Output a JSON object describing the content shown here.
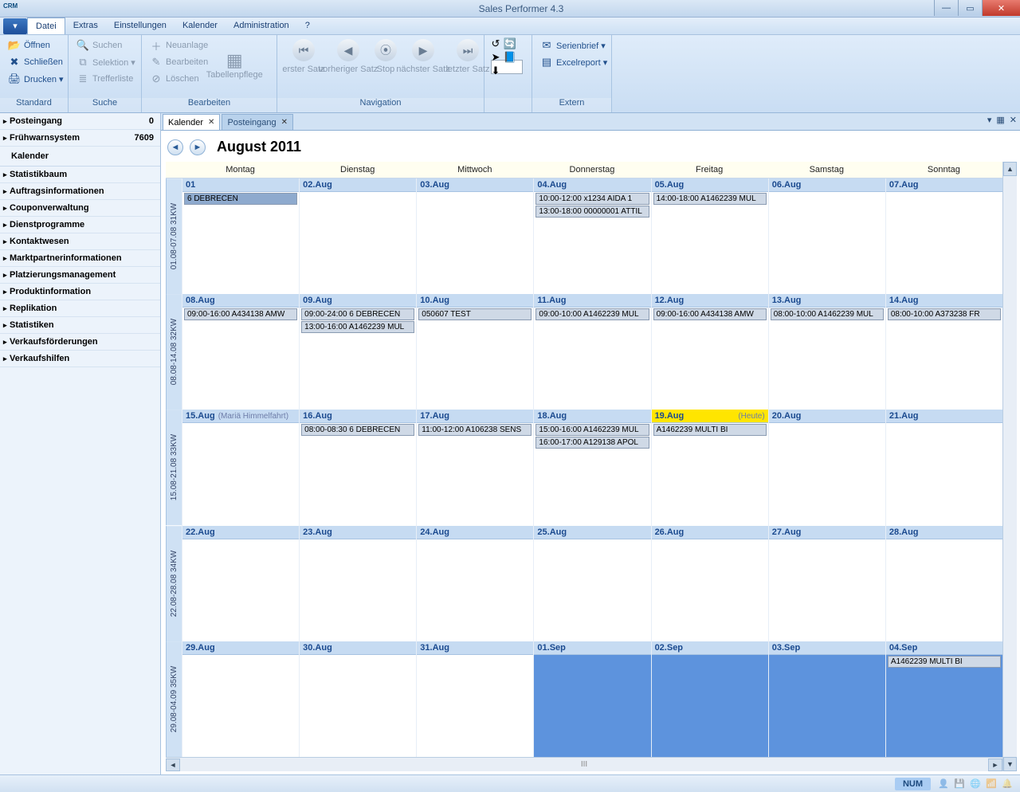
{
  "window": {
    "title": "Sales Performer 4.3",
    "app_icon_label": "CRM"
  },
  "menu": {
    "items": [
      "Datei",
      "Extras",
      "Einstellungen",
      "Kalender",
      "Administration",
      "?"
    ],
    "active_index": 0
  },
  "ribbon": {
    "groups": [
      {
        "label": "Standard",
        "buttons": [
          {
            "label": "Öffnen",
            "icon": "📂"
          },
          {
            "label": "Schließen",
            "icon": "✖"
          },
          {
            "label": "Drucken ▾",
            "icon": "🖨"
          }
        ]
      },
      {
        "label": "Suche",
        "buttons": [
          {
            "label": "Suchen",
            "icon": "🔍",
            "disabled": true
          },
          {
            "label": "Selektion ▾",
            "icon": "⧉",
            "disabled": true
          },
          {
            "label": "Trefferliste",
            "icon": "≣",
            "disabled": true
          }
        ]
      },
      {
        "label": "Bearbeiten",
        "buttons_col": [
          {
            "label": "Neuanlage",
            "icon": "＋",
            "disabled": true
          },
          {
            "label": "Bearbeiten",
            "icon": "✎",
            "disabled": true
          },
          {
            "label": "Löschen",
            "icon": "⊘",
            "disabled": true
          }
        ],
        "big": {
          "label": "Tabellenpflege",
          "icon": "▦",
          "disabled": true
        }
      },
      {
        "label": "Navigation",
        "nav": [
          {
            "label": "erster Satz",
            "glyph": "⏮"
          },
          {
            "label": "vorheriger Satz",
            "glyph": "◀"
          },
          {
            "label": "Stop",
            "glyph": "⦿"
          },
          {
            "label": "nächster Satz",
            "glyph": "▶"
          },
          {
            "label": "letzter Satz",
            "glyph": "⏭"
          }
        ],
        "input_value": ""
      },
      {
        "label": "",
        "mini_icons": true
      },
      {
        "label": "Extern",
        "buttons": [
          {
            "label": "Serienbrief ▾",
            "icon": "✉"
          },
          {
            "label": "Excelreport ▾",
            "icon": "▤"
          }
        ]
      }
    ]
  },
  "nav": {
    "rows": [
      {
        "label": "Posteingang",
        "count": "0"
      },
      {
        "label": "Frühwarnsystem",
        "count": "7609"
      }
    ],
    "sub": "Kalender",
    "items": [
      "Statistikbaum",
      "Auftragsinformationen",
      "Couponverwaltung",
      "Dienstprogramme",
      "Kontaktwesen",
      "Marktpartnerinformationen",
      "Platzierungsmanagement",
      "Produktinformation",
      "Replikation",
      "Statistiken",
      "Verkaufsförderungen",
      "Verkaufshilfen"
    ]
  },
  "tabs": [
    {
      "label": "Kalender",
      "active": true
    },
    {
      "label": "Posteingang",
      "active": false
    }
  ],
  "calendar": {
    "title": "August 2011",
    "days_of_week": [
      "Montag",
      "Dienstag",
      "Mittwoch",
      "Donnerstag",
      "Freitag",
      "Samstag",
      "Sonntag"
    ],
    "weeks": [
      {
        "gutter": "01.08-07.08  31KW",
        "days": [
          {
            "head": "01",
            "events": [
              {
                "t": "6 DEBRECEN",
                "sel": true
              }
            ]
          },
          {
            "head": "02.Aug"
          },
          {
            "head": "03.Aug"
          },
          {
            "head": "04.Aug",
            "events": [
              {
                "t": "10:00-12:00 x1234 AIDA 1"
              },
              {
                "t": "13:00-18:00 00000001 ATTIL"
              }
            ]
          },
          {
            "head": "05.Aug",
            "events": [
              {
                "t": "14:00-18:00  A1462239 MUL"
              }
            ]
          },
          {
            "head": "06.Aug"
          },
          {
            "head": "07.Aug"
          }
        ]
      },
      {
        "gutter": "08.08-14.08  32KW",
        "days": [
          {
            "head": "08.Aug",
            "events": [
              {
                "t": "09:00-16:00 A434138 AMW"
              }
            ]
          },
          {
            "head": "09.Aug",
            "events": [
              {
                "t": "09:00-24:00 6 DEBRECEN"
              },
              {
                "t": "13:00-16:00  A1462239 MUL"
              }
            ]
          },
          {
            "head": "10.Aug",
            "events": [
              {
                "t": "050607 TEST"
              }
            ]
          },
          {
            "head": "11.Aug",
            "events": [
              {
                "t": "09:00-10:00  A1462239 MUL"
              }
            ]
          },
          {
            "head": "12.Aug",
            "events": [
              {
                "t": "09:00-16:00 A434138 AMW"
              }
            ]
          },
          {
            "head": "13.Aug",
            "events": [
              {
                "t": "08:00-10:00  A1462239 MUL"
              }
            ]
          },
          {
            "head": "14.Aug",
            "events": [
              {
                "t": "08:00-10:00  A373238 FR"
              }
            ]
          }
        ]
      },
      {
        "gutter": "15.08-21.08  33KW",
        "days": [
          {
            "head": "15.Aug",
            "sub": "(Mariä Himmelfahrt)"
          },
          {
            "head": "16.Aug",
            "events": [
              {
                "t": "08:00-08:30 6 DEBRECEN"
              }
            ]
          },
          {
            "head": "17.Aug",
            "events": [
              {
                "t": "11:00-12:00 A106238 SENS"
              }
            ]
          },
          {
            "head": "18.Aug",
            "events": [
              {
                "t": "15:00-16:00  A1462239 MUL"
              },
              {
                "t": "16:00-17:00  A129138 APOL"
              }
            ]
          },
          {
            "head": "19.Aug",
            "today": true,
            "heute": "(Heute)",
            "events": [
              {
                "t": "A1462239 MULTI BI"
              }
            ]
          },
          {
            "head": "20.Aug"
          },
          {
            "head": "21.Aug"
          }
        ]
      },
      {
        "gutter": "22.08-28.08  34KW",
        "days": [
          {
            "head": "22.Aug"
          },
          {
            "head": "23.Aug"
          },
          {
            "head": "24.Aug"
          },
          {
            "head": "25.Aug"
          },
          {
            "head": "26.Aug"
          },
          {
            "head": "27.Aug"
          },
          {
            "head": "28.Aug"
          }
        ]
      },
      {
        "gutter": "29.08-04.09  35KW",
        "days": [
          {
            "head": "29.Aug"
          },
          {
            "head": "30.Aug"
          },
          {
            "head": "31.Aug"
          },
          {
            "head": "01.Sep",
            "other": true
          },
          {
            "head": "02.Sep",
            "other": true
          },
          {
            "head": "03.Sep",
            "other": true
          },
          {
            "head": "04.Sep",
            "other": true,
            "events": [
              {
                "t": "A1462239 MULTI BI"
              }
            ]
          }
        ]
      }
    ]
  },
  "status": {
    "num": "NUM"
  },
  "hscroll_mid": "III"
}
